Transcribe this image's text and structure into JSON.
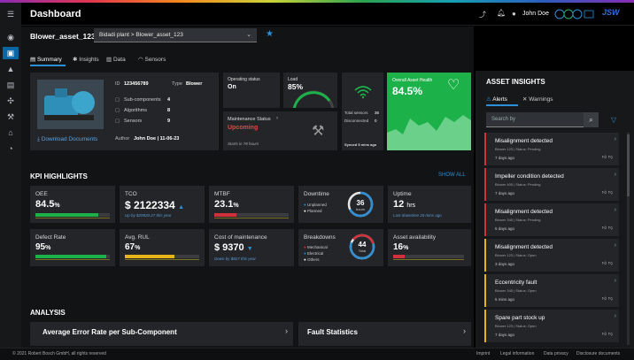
{
  "header": {
    "title": "Dashboard",
    "user": "John Doe",
    "brand": "JSW"
  },
  "asset": {
    "name": "Blower_asset_123",
    "breadcrumb": "Bidadi plant > Blower_asset_123"
  },
  "tabs": [
    "Summary",
    "Insights",
    "Data",
    "Sensors"
  ],
  "info": {
    "id_label": "ID",
    "id_value": "123456789",
    "type_label": "Type",
    "type_value": "Blower",
    "subcomp_label": "Sub-components",
    "subcomp_value": "4",
    "algo_label": "Algorithms",
    "algo_value": "8",
    "sensors_label": "Sensors",
    "sensors_value": "9",
    "author_label": "Author",
    "author_value": "John Doe | 11-06-23",
    "download": "Download Documents"
  },
  "status_tiles": {
    "op_label": "Operating status",
    "op_value": "On",
    "load_label": "Load",
    "load_value": "85%",
    "maint_label": "Maintenance Status",
    "maint_value": "Upcoming",
    "maint_sub": "Starts in 78 hours",
    "sensors_total_label": "Total sensors",
    "sensors_total": "36",
    "disconnected_label": "Disconnected",
    "disconnected": "0",
    "synced": "Synced 5 mins ago",
    "health_label": "Overall Asset Health",
    "health_value": "84.5%"
  },
  "kpi": {
    "title": "KPI HIGHLIGHTS",
    "show_all": "SHOW ALL",
    "oee_label": "OEE",
    "oee_value": "84.5",
    "oee_unit": "%",
    "tco_label": "TCO",
    "tco_value": "$ 2122334",
    "tco_sub": "Up by $29920.27 this year",
    "mtbf_label": "MTBF",
    "mtbf_value": "23.1",
    "mtbf_unit": "%",
    "downtime_label": "Downtime",
    "downtime_l1": "Unplanned",
    "downtime_l2": "Planned",
    "downtime_value": "36",
    "downtime_unit": "hours",
    "uptime_label": "Uptime",
    "uptime_value": "12",
    "uptime_unit": "hrs",
    "uptime_sub": "Last downtime 20 mins ago",
    "defect_label": "Defect Rate",
    "defect_value": "95",
    "defect_unit": "%",
    "rul_label": "Avg. RUL",
    "rul_value": "67",
    "rul_unit": "%",
    "cost_label": "Cost of maintenance",
    "cost_value": "$ 9370",
    "cost_sub": "Down by $827 this year",
    "breakdown_label": "Breakdowns",
    "breakdown_l1": "Mechanical",
    "breakdown_l2": "Electrical",
    "breakdown_l3": "Others",
    "breakdown_value": "44",
    "breakdown_unit": "Total",
    "avail_label": "Asset availability",
    "avail_value": "16",
    "avail_unit": "%"
  },
  "analysis": {
    "title": "ANALYSIS",
    "card1": "Average Error Rate per Sub-Component",
    "card2": "Fault Statistics"
  },
  "insights": {
    "title": "ASSET INSIGHTS",
    "tab_alerts": "Alerts",
    "tab_warnings": "Warnings",
    "search_placeholder": "Search by",
    "alerts": [
      {
        "title": "Misalignment detected",
        "sub": "Blower 123 | Status: Pending",
        "date": "7 days ago"
      },
      {
        "title": "Impeller condition detected",
        "sub": "Blower 405 | Status: Pending",
        "date": "7 days ago"
      },
      {
        "title": "Misalignment detected",
        "sub": "Blower 345 | Status: Pending",
        "date": "5 days ago"
      },
      {
        "title": "Misalignment detected",
        "sub": "Blower 123 | Status: Open",
        "date": "3 days ago"
      },
      {
        "title": "Eccentricity fault",
        "sub": "Blower 345 | Status: Open",
        "date": "5 mins ago"
      },
      {
        "title": "Spare part stock up",
        "sub": "Blower 123 | Status: Open",
        "date": "7 days ago"
      }
    ]
  },
  "footer": {
    "copyright": "© 2021 Robert Bosch GmbH, all rights reserved",
    "imprint": "Imprint",
    "legal": "Legal information",
    "privacy": "Data privacy",
    "disclosure": "Disclosure documents"
  },
  "colors": {
    "accent": "#0a67a3",
    "green": "#1db14a",
    "red": "#d0313a",
    "yellow": "#e6b417",
    "blue": "#2d8fd5"
  },
  "bars": {
    "oee": 0.845,
    "tco": 0.0,
    "mtbf": 0.3,
    "defect": 0.95,
    "rul": 0.67,
    "avail": 0.16
  }
}
